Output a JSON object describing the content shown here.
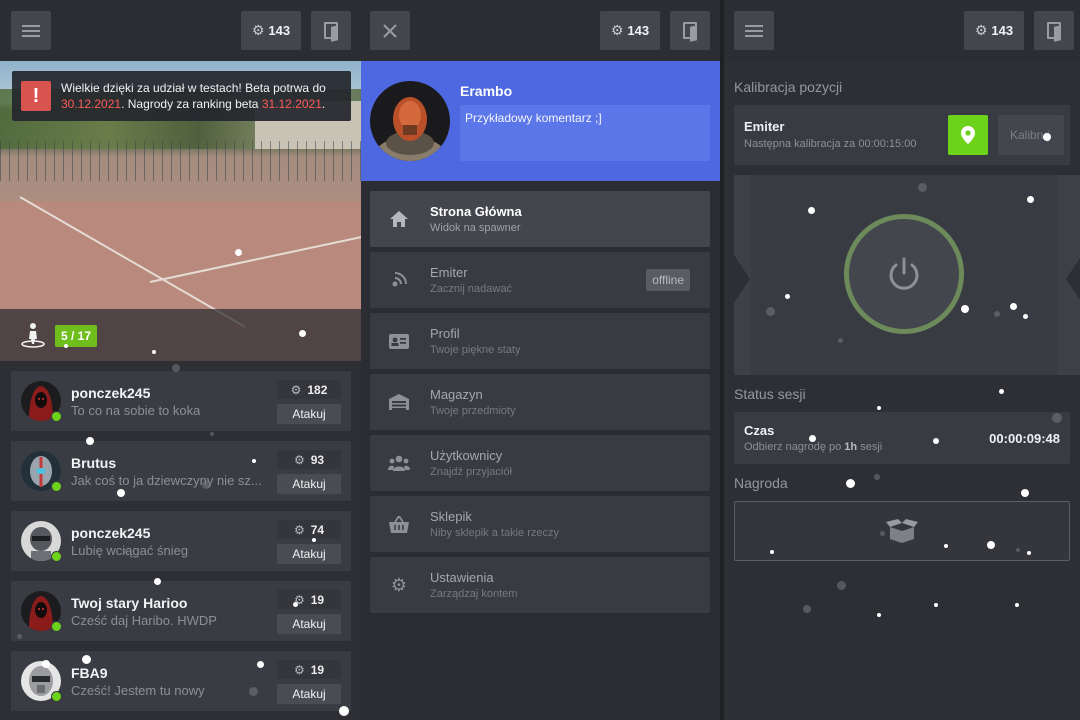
{
  "header": {
    "coins": "143"
  },
  "feed": {
    "notice": {
      "text_before": "Wielkie dzięki za udział w testach! Beta potrwa do",
      "date1": "30.12.2021",
      "text_mid": ". Nagrody za ranking beta",
      "date2": "31.12.2021",
      "text_after": "."
    },
    "player_count": "5 / 17",
    "players": [
      {
        "name": "ponczek245",
        "status": "To co na sobie to koka",
        "points": "182",
        "action": "Atakuj",
        "avatar": "red-hood"
      },
      {
        "name": "Brutus",
        "status": "Jak coś to ja dziewczyny nie sz...",
        "points": "93",
        "action": "Atakuj",
        "avatar": "cyborg"
      },
      {
        "name": "ponczek245",
        "status": "Lubię wciągać śnieg",
        "points": "74",
        "action": "Atakuj",
        "avatar": "robot"
      },
      {
        "name": "Twoj stary Harioo",
        "status": "Cześć daj Haribo. HWDP",
        "points": "19",
        "action": "Atakuj",
        "avatar": "red-hood"
      },
      {
        "name": "FBA9",
        "status": "Cześć! Jestem tu nowy",
        "points": "19",
        "action": "Atakuj",
        "avatar": "helmet"
      }
    ]
  },
  "profile": {
    "name": "Erambo",
    "comment": "Przykładowy komentarz ;]"
  },
  "menu": [
    {
      "title": "Strona Główna",
      "subtitle": "Widok na spawner",
      "icon": "home-icon",
      "active": true
    },
    {
      "title": "Emiter",
      "subtitle": "Zacznij nadawać",
      "icon": "broadcast-icon",
      "badge": "offline"
    },
    {
      "title": "Profil",
      "subtitle": "Twoje piękne staty",
      "icon": "id-card-icon"
    },
    {
      "title": "Magazyn",
      "subtitle": "Twoje przedmioty",
      "icon": "warehouse-icon"
    },
    {
      "title": "Użytkownicy",
      "subtitle": "Znajdź przyjaciół",
      "icon": "users-icon"
    },
    {
      "title": "Sklepik",
      "subtitle": "Niby sklepik a takie rzeczy",
      "icon": "basket-icon"
    },
    {
      "title": "Ustawienia",
      "subtitle": "Zarządzaj kontem",
      "icon": "gear-icon"
    }
  ],
  "right": {
    "calibration_label": "Kalibracja pozycji",
    "emiter_title": "Emiter",
    "emiter_sub": "Następna kalibracja za 00:00:15:00",
    "calibrate_btn": "Kalibruj",
    "session_label": "Status sesji",
    "session_title": "Czas",
    "session_sub_before": "Odbierz nagrodę po",
    "session_sub_bold": "1h",
    "session_sub_after": "sesji",
    "session_time": "00:00:09:48",
    "reward_label": "Nagroda"
  },
  "colors": {
    "accent_blue": "#4d68e0",
    "online_green": "#6dd21a",
    "alert_red": "#d9534f",
    "date_red": "#ff5b55"
  }
}
